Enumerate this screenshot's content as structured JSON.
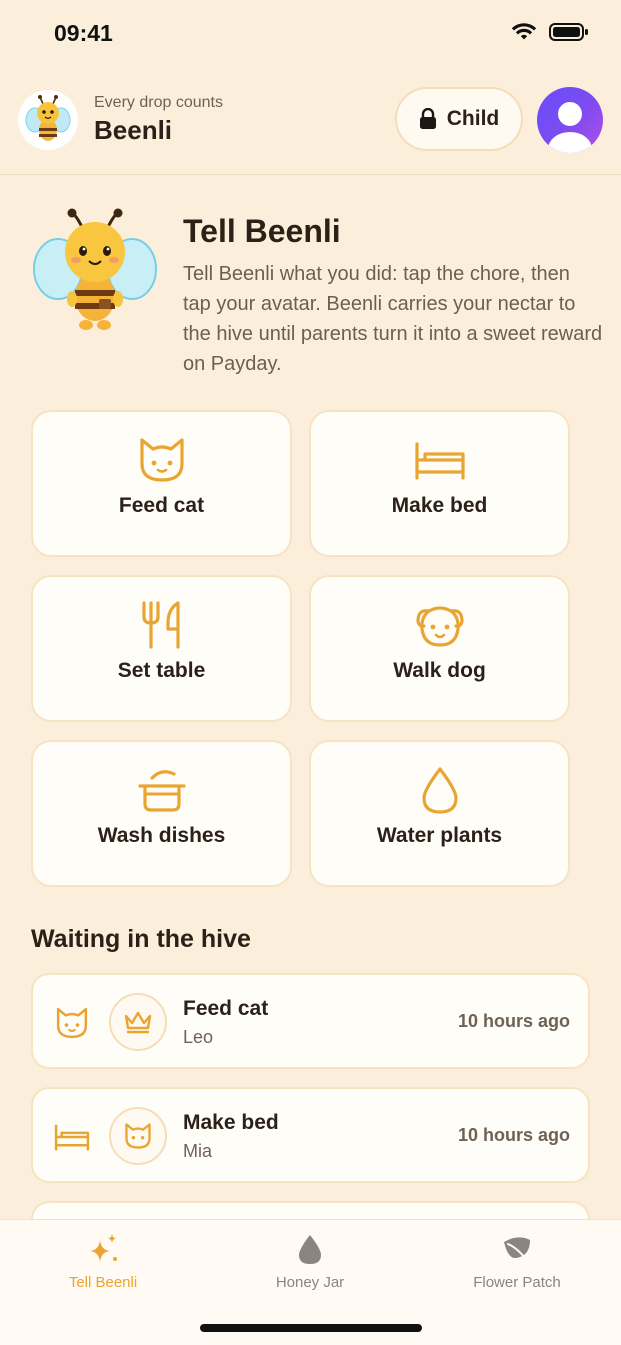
{
  "status_bar": {
    "time": "09:41"
  },
  "header": {
    "tagline": "Every drop counts",
    "brand": "Beenli",
    "mode_label": "Child"
  },
  "intro": {
    "title": "Tell Beenli",
    "description": "Tell Beenli what you did: tap the chore, then tap your avatar. Beenli carries your nectar to the hive until parents turn it into a sweet reward on Payday."
  },
  "chores": [
    {
      "label": "Feed cat",
      "icon": "cat-icon"
    },
    {
      "label": "Make bed",
      "icon": "bed-icon"
    },
    {
      "label": "Set table",
      "icon": "fork-knife-icon"
    },
    {
      "label": "Walk dog",
      "icon": "dog-icon"
    },
    {
      "label": "Wash dishes",
      "icon": "pot-icon"
    },
    {
      "label": "Water plants",
      "icon": "water-drop-icon"
    }
  ],
  "waiting": {
    "title": "Waiting in the hive",
    "items": [
      {
        "chore": "Feed cat",
        "kid": "Leo",
        "time": "10 hours ago",
        "chore_icon": "cat-icon",
        "avatar_icon": "crown-icon"
      },
      {
        "chore": "Make bed",
        "kid": "Mia",
        "time": "10 hours ago",
        "chore_icon": "bed-icon",
        "avatar_icon": "cat-icon"
      }
    ]
  },
  "tabs": [
    {
      "label": "Tell Beenli",
      "icon": "sparkles-icon",
      "active": true
    },
    {
      "label": "Honey Jar",
      "icon": "drop-icon",
      "active": false
    },
    {
      "label": "Flower Patch",
      "icon": "leaf-icon",
      "active": false
    }
  ],
  "colors": {
    "background": "#fbefdc",
    "accent": "#e9a531",
    "card": "#fffdf8",
    "card_border": "#f6e3c4"
  }
}
